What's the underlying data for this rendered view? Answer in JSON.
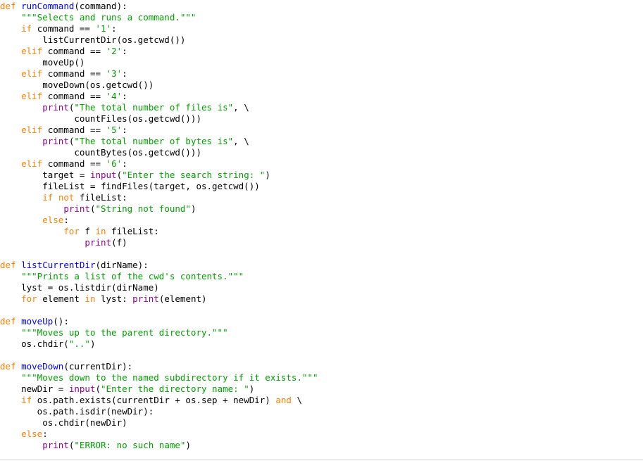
{
  "document": {
    "kind": "python-source-listing",
    "language": "Python",
    "colors": {
      "background": "#ffffff",
      "keyword": "#ff8000",
      "function_name": "#0000ff",
      "builtin": "#900090",
      "string": "#00a000",
      "docstring": "#00a000",
      "identifier": "#000000",
      "rule": "#d8d8d8"
    }
  },
  "lines": [
    {
      "id": "line-1",
      "tokens": [
        {
          "t": "def",
          "c": "def"
        },
        {
          "t": " ",
          "c": "plain"
        },
        {
          "t": "runCommand",
          "c": "fname"
        },
        {
          "t": "(command):",
          "c": "plain"
        }
      ]
    },
    {
      "id": "line-2",
      "tokens": [
        {
          "t": "    ",
          "c": "plain"
        },
        {
          "t": "\"\"\"Selects and runs a command.\"\"\"",
          "c": "doc"
        }
      ]
    },
    {
      "id": "line-3",
      "tokens": [
        {
          "t": "    ",
          "c": "plain"
        },
        {
          "t": "if",
          "c": "kw"
        },
        {
          "t": " command ",
          "c": "plain"
        },
        {
          "t": "==",
          "c": "op"
        },
        {
          "t": " ",
          "c": "plain"
        },
        {
          "t": "'1'",
          "c": "str"
        },
        {
          "t": ":",
          "c": "plain"
        }
      ]
    },
    {
      "id": "line-4",
      "tokens": [
        {
          "t": "        listCurrentDir(os.getcwd())",
          "c": "plain"
        }
      ]
    },
    {
      "id": "line-5",
      "tokens": [
        {
          "t": "    ",
          "c": "plain"
        },
        {
          "t": "elif",
          "c": "kw"
        },
        {
          "t": " command ",
          "c": "plain"
        },
        {
          "t": "==",
          "c": "op"
        },
        {
          "t": " ",
          "c": "plain"
        },
        {
          "t": "'2'",
          "c": "str"
        },
        {
          "t": ":",
          "c": "plain"
        }
      ]
    },
    {
      "id": "line-6",
      "tokens": [
        {
          "t": "        moveUp()",
          "c": "plain"
        }
      ]
    },
    {
      "id": "line-7",
      "tokens": [
        {
          "t": "    ",
          "c": "plain"
        },
        {
          "t": "elif",
          "c": "kw"
        },
        {
          "t": " command ",
          "c": "plain"
        },
        {
          "t": "==",
          "c": "op"
        },
        {
          "t": " ",
          "c": "plain"
        },
        {
          "t": "'3'",
          "c": "str"
        },
        {
          "t": ":",
          "c": "plain"
        }
      ]
    },
    {
      "id": "line-8",
      "tokens": [
        {
          "t": "        moveDown(os.getcwd())",
          "c": "plain"
        }
      ]
    },
    {
      "id": "line-9",
      "tokens": [
        {
          "t": "    ",
          "c": "plain"
        },
        {
          "t": "elif",
          "c": "kw"
        },
        {
          "t": " command ",
          "c": "plain"
        },
        {
          "t": "==",
          "c": "op"
        },
        {
          "t": " ",
          "c": "plain"
        },
        {
          "t": "'4'",
          "c": "str"
        },
        {
          "t": ":",
          "c": "plain"
        }
      ]
    },
    {
      "id": "line-10",
      "tokens": [
        {
          "t": "        ",
          "c": "plain"
        },
        {
          "t": "print",
          "c": "builtin"
        },
        {
          "t": "(",
          "c": "plain"
        },
        {
          "t": "\"The total number of files is\"",
          "c": "str"
        },
        {
          "t": ", \\",
          "c": "plain"
        }
      ]
    },
    {
      "id": "line-11",
      "tokens": [
        {
          "t": "              countFiles(os.getcwd()))",
          "c": "plain"
        }
      ]
    },
    {
      "id": "line-12",
      "tokens": [
        {
          "t": "    ",
          "c": "plain"
        },
        {
          "t": "elif",
          "c": "kw"
        },
        {
          "t": " command ",
          "c": "plain"
        },
        {
          "t": "==",
          "c": "op"
        },
        {
          "t": " ",
          "c": "plain"
        },
        {
          "t": "'5'",
          "c": "str"
        },
        {
          "t": ":",
          "c": "plain"
        }
      ]
    },
    {
      "id": "line-13",
      "tokens": [
        {
          "t": "        ",
          "c": "plain"
        },
        {
          "t": "print",
          "c": "builtin"
        },
        {
          "t": "(",
          "c": "plain"
        },
        {
          "t": "\"The total number of bytes is\"",
          "c": "str"
        },
        {
          "t": ", \\",
          "c": "plain"
        }
      ]
    },
    {
      "id": "line-14",
      "tokens": [
        {
          "t": "              countBytes(os.getcwd()))",
          "c": "plain"
        }
      ]
    },
    {
      "id": "line-15",
      "tokens": [
        {
          "t": "    ",
          "c": "plain"
        },
        {
          "t": "elif",
          "c": "kw"
        },
        {
          "t": " command ",
          "c": "plain"
        },
        {
          "t": "==",
          "c": "op"
        },
        {
          "t": " ",
          "c": "plain"
        },
        {
          "t": "'6'",
          "c": "str"
        },
        {
          "t": ":",
          "c": "plain"
        }
      ]
    },
    {
      "id": "line-16",
      "tokens": [
        {
          "t": "        target = ",
          "c": "plain"
        },
        {
          "t": "input",
          "c": "builtin"
        },
        {
          "t": "(",
          "c": "plain"
        },
        {
          "t": "\"Enter the search string: \"",
          "c": "str"
        },
        {
          "t": ")",
          "c": "plain"
        }
      ]
    },
    {
      "id": "line-17",
      "tokens": [
        {
          "t": "        fileList = findFiles(target, os.getcwd())",
          "c": "plain"
        }
      ]
    },
    {
      "id": "line-18",
      "tokens": [
        {
          "t": "        ",
          "c": "plain"
        },
        {
          "t": "if",
          "c": "kw"
        },
        {
          "t": " ",
          "c": "plain"
        },
        {
          "t": "not",
          "c": "kw"
        },
        {
          "t": " fileList:",
          "c": "plain"
        }
      ]
    },
    {
      "id": "line-19",
      "tokens": [
        {
          "t": "            ",
          "c": "plain"
        },
        {
          "t": "print",
          "c": "builtin"
        },
        {
          "t": "(",
          "c": "plain"
        },
        {
          "t": "\"String not found\"",
          "c": "str"
        },
        {
          "t": ")",
          "c": "plain"
        }
      ]
    },
    {
      "id": "line-20",
      "tokens": [
        {
          "t": "        ",
          "c": "plain"
        },
        {
          "t": "else",
          "c": "kw"
        },
        {
          "t": ":",
          "c": "plain"
        }
      ]
    },
    {
      "id": "line-21",
      "tokens": [
        {
          "t": "            ",
          "c": "plain"
        },
        {
          "t": "for",
          "c": "kw"
        },
        {
          "t": " f ",
          "c": "plain"
        },
        {
          "t": "in",
          "c": "kw"
        },
        {
          "t": " fileList:",
          "c": "plain"
        }
      ]
    },
    {
      "id": "line-22",
      "tokens": [
        {
          "t": "                ",
          "c": "plain"
        },
        {
          "t": "print",
          "c": "builtin"
        },
        {
          "t": "(f)",
          "c": "plain"
        }
      ]
    },
    {
      "id": "line-23",
      "tokens": [
        {
          "t": "",
          "c": "plain"
        }
      ]
    },
    {
      "id": "line-24",
      "tokens": [
        {
          "t": "def",
          "c": "def"
        },
        {
          "t": " ",
          "c": "plain"
        },
        {
          "t": "listCurrentDir",
          "c": "fname"
        },
        {
          "t": "(dirName):",
          "c": "plain"
        }
      ]
    },
    {
      "id": "line-25",
      "tokens": [
        {
          "t": "    ",
          "c": "plain"
        },
        {
          "t": "\"\"\"Prints a list of the cwd's contents.\"\"\"",
          "c": "doc"
        }
      ]
    },
    {
      "id": "line-26",
      "tokens": [
        {
          "t": "    lyst = os.listdir(dirName)",
          "c": "plain"
        }
      ]
    },
    {
      "id": "line-27",
      "tokens": [
        {
          "t": "    ",
          "c": "plain"
        },
        {
          "t": "for",
          "c": "kw"
        },
        {
          "t": " element ",
          "c": "plain"
        },
        {
          "t": "in",
          "c": "kw"
        },
        {
          "t": " lyst: ",
          "c": "plain"
        },
        {
          "t": "print",
          "c": "builtin"
        },
        {
          "t": "(element)",
          "c": "plain"
        }
      ]
    },
    {
      "id": "line-28",
      "tokens": [
        {
          "t": "",
          "c": "plain"
        }
      ]
    },
    {
      "id": "line-29",
      "tokens": [
        {
          "t": "def",
          "c": "def"
        },
        {
          "t": " ",
          "c": "plain"
        },
        {
          "t": "moveUp",
          "c": "fname"
        },
        {
          "t": "():",
          "c": "plain"
        }
      ]
    },
    {
      "id": "line-30",
      "tokens": [
        {
          "t": "    ",
          "c": "plain"
        },
        {
          "t": "\"\"\"Moves up to the parent directory.\"\"\"",
          "c": "doc"
        }
      ]
    },
    {
      "id": "line-31",
      "tokens": [
        {
          "t": "    os.chdir(",
          "c": "plain"
        },
        {
          "t": "\"..\"",
          "c": "str"
        },
        {
          "t": ")",
          "c": "plain"
        }
      ]
    },
    {
      "id": "line-32",
      "tokens": [
        {
          "t": "",
          "c": "plain"
        }
      ]
    },
    {
      "id": "line-33",
      "tokens": [
        {
          "t": "def",
          "c": "def"
        },
        {
          "t": " ",
          "c": "plain"
        },
        {
          "t": "moveDown",
          "c": "fname"
        },
        {
          "t": "(currentDir):",
          "c": "plain"
        }
      ]
    },
    {
      "id": "line-34",
      "tokens": [
        {
          "t": "    ",
          "c": "plain"
        },
        {
          "t": "\"\"\"Moves down to the named subdirectory if it exists.\"\"\"",
          "c": "doc"
        }
      ]
    },
    {
      "id": "line-35",
      "tokens": [
        {
          "t": "    newDir = ",
          "c": "plain"
        },
        {
          "t": "input",
          "c": "builtin"
        },
        {
          "t": "(",
          "c": "plain"
        },
        {
          "t": "\"Enter the directory name: \"",
          "c": "str"
        },
        {
          "t": ")",
          "c": "plain"
        }
      ]
    },
    {
      "id": "line-36",
      "tokens": [
        {
          "t": "    ",
          "c": "plain"
        },
        {
          "t": "if",
          "c": "kw"
        },
        {
          "t": " os.path.exists(currentDir + os.sep + newDir) ",
          "c": "plain"
        },
        {
          "t": "and",
          "c": "kw"
        },
        {
          "t": " \\",
          "c": "plain"
        }
      ]
    },
    {
      "id": "line-37",
      "tokens": [
        {
          "t": "       os.path.isdir(newDir):",
          "c": "plain"
        }
      ]
    },
    {
      "id": "line-38",
      "tokens": [
        {
          "t": "        os.chdir(newDir)",
          "c": "plain"
        }
      ]
    },
    {
      "id": "line-39",
      "tokens": [
        {
          "t": "    ",
          "c": "plain"
        },
        {
          "t": "else",
          "c": "kw"
        },
        {
          "t": ":",
          "c": "plain"
        }
      ]
    },
    {
      "id": "line-40",
      "tokens": [
        {
          "t": "        ",
          "c": "plain"
        },
        {
          "t": "print",
          "c": "builtin"
        },
        {
          "t": "(",
          "c": "plain"
        },
        {
          "t": "\"ERROR: no such name\"",
          "c": "str"
        },
        {
          "t": ")",
          "c": "plain"
        }
      ]
    }
  ]
}
